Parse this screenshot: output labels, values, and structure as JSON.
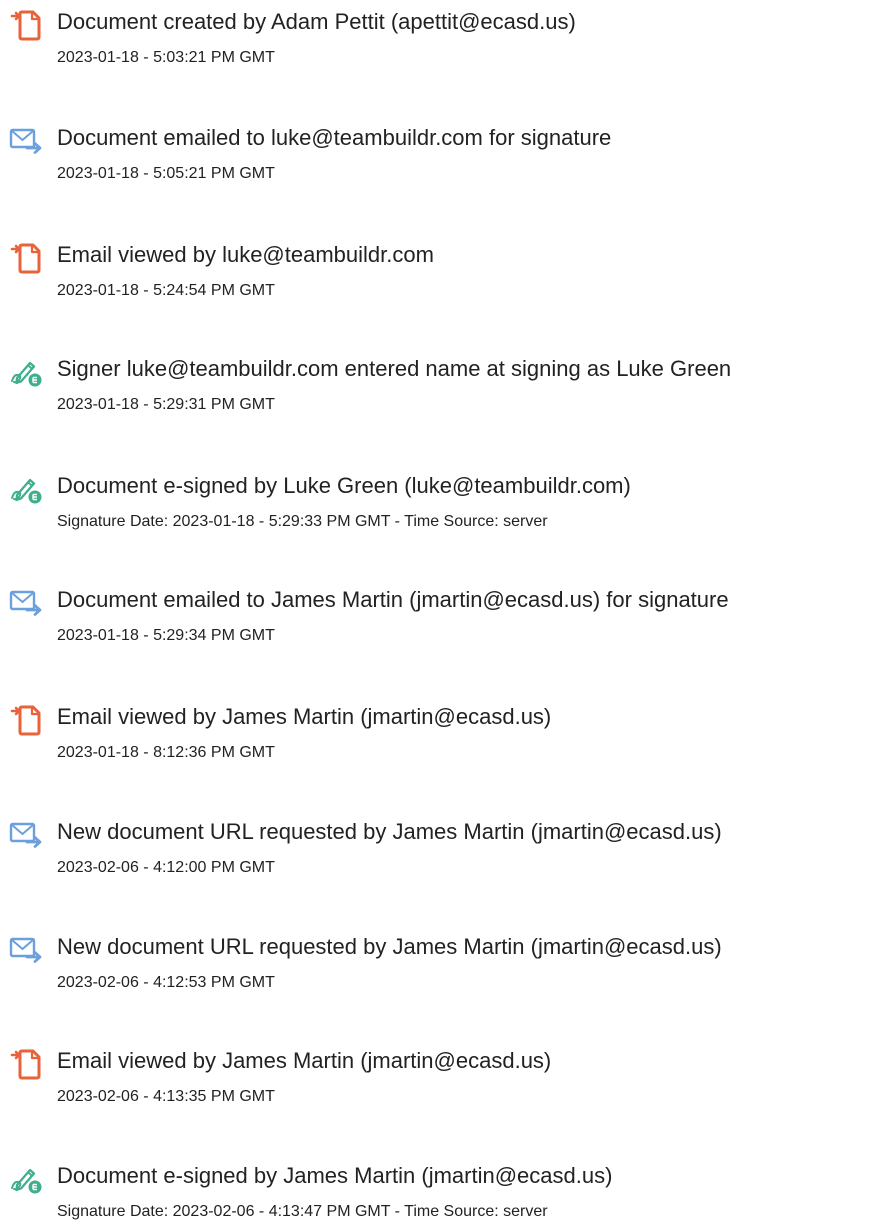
{
  "events": [
    {
      "icon": "document-created-icon",
      "title": "Document created by Adam Pettit (apettit@ecasd.us)",
      "timestamp": "2023-01-18 - 5:03:21 PM GMT"
    },
    {
      "icon": "email-sent-icon",
      "title": "Document emailed to luke@teambuildr.com for signature",
      "timestamp": "2023-01-18 - 5:05:21 PM GMT"
    },
    {
      "icon": "email-viewed-icon",
      "title": "Email viewed by luke@teambuildr.com",
      "timestamp": "2023-01-18 - 5:24:54 PM GMT"
    },
    {
      "icon": "signature-pen-icon",
      "title": "Signer luke@teambuildr.com entered name at signing as Luke Green",
      "timestamp": "2023-01-18 - 5:29:31 PM GMT"
    },
    {
      "icon": "signature-pen-icon",
      "title": "Document e-signed by Luke Green (luke@teambuildr.com)",
      "timestamp": "Signature Date: 2023-01-18 - 5:29:33 PM GMT - Time Source: server"
    },
    {
      "icon": "email-sent-icon",
      "title": "Document emailed to James Martin (jmartin@ecasd.us) for signature",
      "timestamp": "2023-01-18 - 5:29:34 PM GMT"
    },
    {
      "icon": "email-viewed-icon",
      "title": "Email viewed by James Martin (jmartin@ecasd.us)",
      "timestamp": "2023-01-18 - 8:12:36 PM GMT"
    },
    {
      "icon": "email-sent-icon",
      "title": "New document URL requested by James Martin (jmartin@ecasd.us)",
      "timestamp": "2023-02-06 - 4:12:00 PM GMT"
    },
    {
      "icon": "email-sent-icon",
      "title": "New document URL requested by James Martin (jmartin@ecasd.us)",
      "timestamp": "2023-02-06 - 4:12:53 PM GMT"
    },
    {
      "icon": "email-viewed-icon",
      "title": "Email viewed by James Martin (jmartin@ecasd.us)",
      "timestamp": "2023-02-06 - 4:13:35 PM GMT"
    },
    {
      "icon": "signature-pen-icon",
      "title": "Document e-signed by James Martin (jmartin@ecasd.us)",
      "timestamp": "Signature Date: 2023-02-06 - 4:13:47 PM GMT - Time Source: server"
    }
  ],
  "colors": {
    "document_icon": "#E8623A",
    "email_icon": "#6CA0DC",
    "signature_icon": "#3FAE8C",
    "text": "#222222"
  }
}
